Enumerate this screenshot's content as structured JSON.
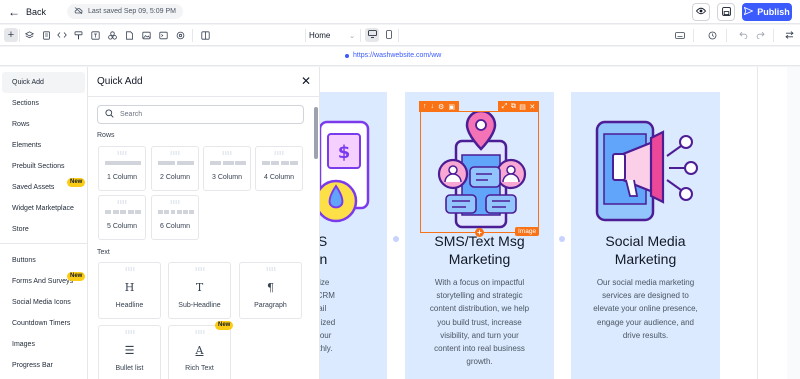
{
  "topbar": {
    "back_label": "Back",
    "saved_text": "Last saved Sep 09, 5:09 PM",
    "publish_label": "Publish"
  },
  "toolbar": {
    "page": "Home",
    "icons": [
      "plus-icon",
      "layers-icon",
      "pages-icon",
      "code-icon",
      "paint-icon",
      "form-icon",
      "shapes-icon",
      "file-icon",
      "image-icon",
      "terminal-icon",
      "settings-icon",
      "columns-icon"
    ]
  },
  "url": "https://washwebsite.com/ww",
  "categories": {
    "items": [
      {
        "label": "Quick Add",
        "active": true
      },
      {
        "label": "Sections"
      },
      {
        "label": "Rows"
      },
      {
        "label": "Elements"
      },
      {
        "label": "Prebuilt Sections"
      },
      {
        "label": "Saved Assets",
        "badge": "New"
      },
      {
        "label": "Widget Marketplace"
      },
      {
        "label": "Store"
      },
      {
        "label": "Buttons"
      },
      {
        "label": "Forms And Surveys",
        "badge": "New"
      },
      {
        "label": "Social Media Icons"
      },
      {
        "label": "Countdown Timers"
      },
      {
        "label": "Images"
      },
      {
        "label": "Progress Bar"
      }
    ]
  },
  "quick_add": {
    "title": "Quick Add",
    "search_placeholder": "Search",
    "rows_label": "Rows",
    "rows": [
      {
        "label": "1 Column",
        "cols": 1
      },
      {
        "label": "2 Column",
        "cols": 2
      },
      {
        "label": "3 Column",
        "cols": 3
      },
      {
        "label": "4 Column",
        "cols": 4
      },
      {
        "label": "5 Column",
        "cols": 5
      },
      {
        "label": "6 Column",
        "cols": 6
      }
    ],
    "text_label": "Text",
    "text_items": [
      {
        "label": "Headline",
        "icon": "heading-icon"
      },
      {
        "label": "Sub-Headline",
        "icon": "subheading-icon"
      },
      {
        "label": "Paragraph",
        "icon": "paragraph-icon"
      },
      {
        "label": "Bullet list",
        "icon": "bullet-list-icon"
      },
      {
        "label": "Rich Text",
        "icon": "rich-text-icon",
        "badge": "New"
      }
    ]
  },
  "cards": [
    {
      "title_lines": [
        "POS",
        "ction"
      ],
      "text_lines": [
        "l optimize",
        "cflows, CRM",
        "s, email",
        "personalized",
        "nsure your",
        "s smoothly."
      ]
    },
    {
      "title_lines": [
        "SMS/Text Msg",
        "Marketing"
      ],
      "text_lines": [
        "With a focus on impactful",
        "storytelling and strategic",
        "content distribution, we help",
        "you build trust, increase",
        "visibility, and turn your",
        "content into real business",
        "growth."
      ],
      "image_tag": "Image"
    },
    {
      "title_lines": [
        "Social Media",
        "Marketing"
      ],
      "text_lines": [
        "Our social media marketing",
        "services are designed to",
        "elevate your online presence,",
        "engage your audience, and",
        "drive results."
      ]
    }
  ],
  "colors": {
    "accent": "#3b5bfd",
    "selection": "#f97316",
    "card_bg": "#dbeafe",
    "badge": "#facc15"
  }
}
